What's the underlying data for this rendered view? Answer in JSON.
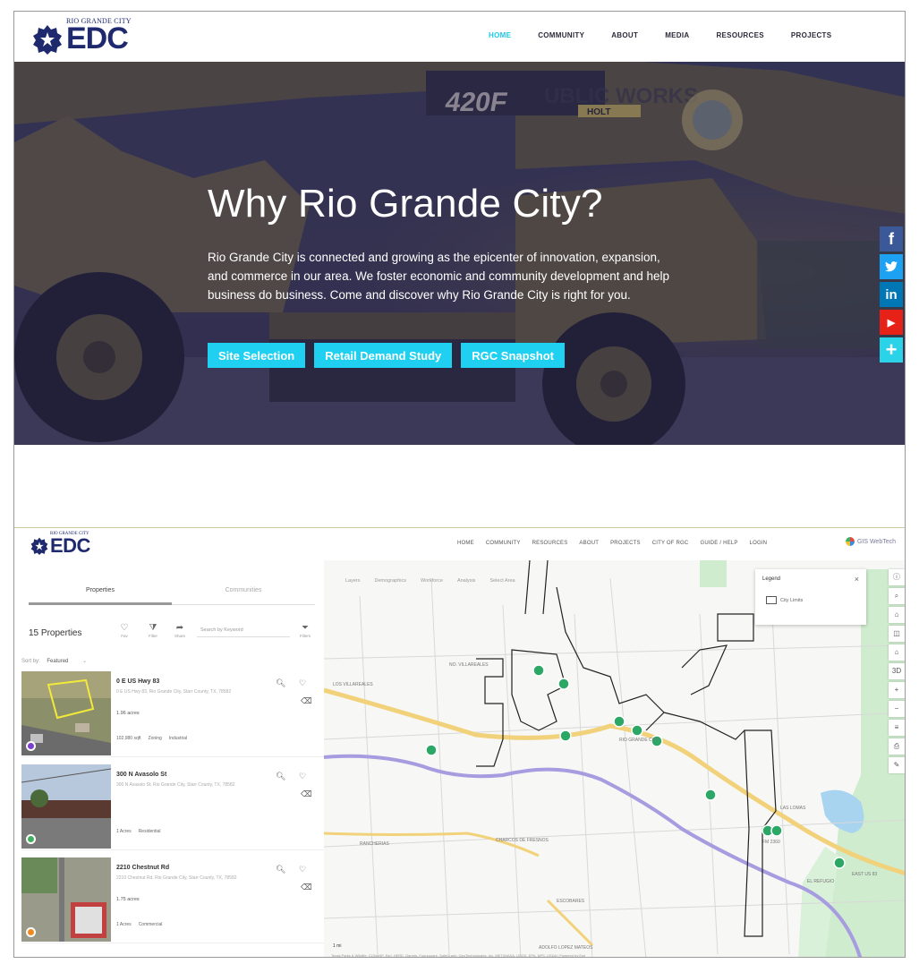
{
  "site": {
    "logo": {
      "tagline": "RIO GRANDE CITY",
      "wordmark": "EDC"
    },
    "nav": [
      {
        "label": "HOME",
        "active": true
      },
      {
        "label": "COMMUNITY",
        "active": false
      },
      {
        "label": "ABOUT",
        "active": false
      },
      {
        "label": "MEDIA",
        "active": false
      },
      {
        "label": "RESOURCES",
        "active": false
      },
      {
        "label": "PROJECTS",
        "active": false
      }
    ]
  },
  "hero": {
    "background_text": {
      "model": "420F",
      "sign": "UBLIC WORKS",
      "brand": "HOLT"
    },
    "title": "Why Rio Grande City?",
    "body": "Rio Grande City is connected and growing as the epicenter of innovation, expansion, and commerce in our area. We foster economic and community development and help business do business. Come and discover why Rio Grande City is right for you.",
    "buttons": [
      "Site Selection",
      "Retail Demand Study",
      "RGC Snapshot"
    ],
    "accent": "#1fd0f0"
  },
  "social": [
    {
      "name": "facebook-icon",
      "glyph": "f",
      "color": "#3b5998"
    },
    {
      "name": "twitter-icon",
      "glyph": "t",
      "color": "#1da1f2"
    },
    {
      "name": "linkedin-icon",
      "glyph": "in",
      "color": "#0077b5"
    },
    {
      "name": "youtube-icon",
      "glyph": "▶",
      "color": "#e62117"
    },
    {
      "name": "share-plus-icon",
      "glyph": "+",
      "color": "#2ad3e8"
    }
  ],
  "gis": {
    "logo": {
      "tagline": "RIO GRANDE CITY",
      "wordmark": "EDC"
    },
    "nav": [
      "HOME",
      "COMMUNITY",
      "RESOURCES",
      "ABOUT",
      "PROJECTS",
      "CITY OF RGC",
      "GUIDE / HELP",
      "LOGIN"
    ],
    "brand": "GIS WebTech",
    "panel": {
      "tabs": [
        "Properties",
        "Communities"
      ],
      "count": "15 Properties",
      "tools": [
        {
          "icon": "heart-icon",
          "glyph": "♡",
          "label": "Fav"
        },
        {
          "icon": "filter-icon",
          "glyph": "⧩",
          "label": "Filter"
        },
        {
          "icon": "share-icon",
          "glyph": "➦",
          "label": "Share"
        }
      ],
      "search_placeholder": "Search by Keyword",
      "filter_label": "Filters",
      "sort_label": "Sort by:",
      "sort_value": "Featured",
      "properties": [
        {
          "title": "0 E US Hwy 83",
          "address": "0 E US Hwy 83, Rio Grande City, Starr County, TX, 78582",
          "size": "1.96 acres",
          "meta": [
            "102,980 sqft",
            "Zoning",
            "Industrial"
          ],
          "pin_color": "#7b3fd0"
        },
        {
          "title": "300 N Avasolo St",
          "address": "300 N Avasolo St, Rio Grande City, Starr County, TX, 78582",
          "size": "",
          "meta": [
            "1 Acres",
            "Residential"
          ],
          "pin_color": "#40b060"
        },
        {
          "title": "2210 Chestnut Rd",
          "address": "2210 Chestnut Rd, Rio Grande City, Starr County, TX, 78582",
          "size": "1.75 acres",
          "meta": [
            "1 Acres",
            "Commercial"
          ],
          "pin_color": "#f08a20"
        }
      ]
    },
    "map": {
      "tabs": [
        "Layers",
        "Demographics",
        "Workforce",
        "Analysis",
        "Select Area"
      ],
      "legend": {
        "title": "Legend",
        "item": "City Limits"
      },
      "place_labels": [
        "LOS VILLAREALES",
        "NO. VILLAREALES",
        "RIO GRANDE CITY",
        "LAS LOMAS",
        "RANCHERIAS",
        "CHARCOS DE FRESNOS",
        "ESCOBARES",
        "ADOLFO LOPEZ MATEOS",
        "EL REFUGIO",
        "FM 2360",
        "EAST US 83"
      ],
      "scale": "1 mi",
      "attribution": "Texas Parks & Wildlife, CONANP, Esri, HERE, Garmin, Foursquare, SafeGraph, GeoTechnologies, Inc, METI/NASA, USGS, EPA, NPS, USDA | Powered by Esri"
    }
  }
}
